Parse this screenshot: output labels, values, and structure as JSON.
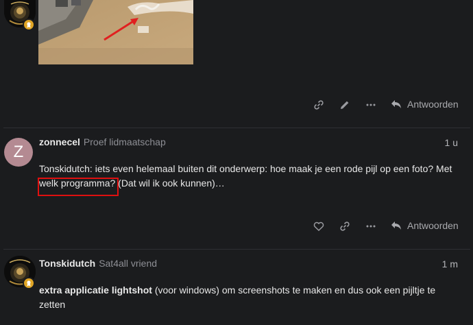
{
  "post1": {
    "actions": {
      "reply_label": "Antwoorden"
    }
  },
  "post2": {
    "avatar_letter": "Z",
    "username": "zonnecel",
    "user_title": "Proef lidmaatschap",
    "time": "1 u",
    "text_line1": "Tonskidutch: iets even helemaal buiten dit onderwerp: hoe maak je een rode pijl op een foto? Met",
    "text_line2_highlighted": "welk programma?",
    "text_line2_rest": " (Dat wil ik ook kunnen)…",
    "actions": {
      "reply_label": "Antwoorden"
    }
  },
  "post3": {
    "username": "Tonskidutch",
    "user_title": "Sat4all vriend",
    "time": "1 m",
    "text_bold": "extra applicatie lightshot",
    "text_rest_line1": " (voor windows) om screenshots te maken en dus ook een pijltje te",
    "text_line2": "zetten"
  },
  "colors": {
    "background": "#1b1c1e",
    "badge": "#e0a526",
    "avatar_z": "#b48a92",
    "highlight_box": "#e01010",
    "arrow": "#e02020"
  }
}
